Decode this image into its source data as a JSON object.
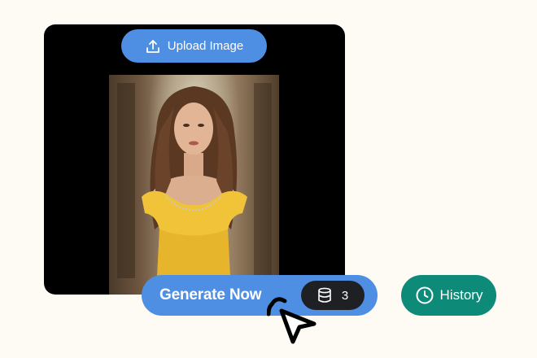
{
  "upload": {
    "label": "Upload Image",
    "icon": "upload-icon"
  },
  "generate": {
    "label": "Generate Now",
    "credits": "3",
    "credit_icon": "database-icon"
  },
  "history": {
    "label": "History",
    "icon": "clock-icon"
  },
  "colors": {
    "background": "#fdfbf3",
    "primary": "#4f8fe3",
    "history": "#0d8a78",
    "badge": "#1f2024",
    "preview_bg": "#000000"
  }
}
